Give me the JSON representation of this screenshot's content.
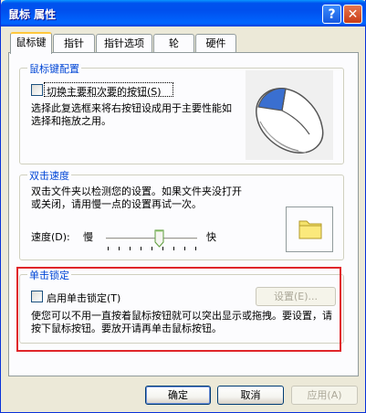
{
  "window": {
    "title": "鼠标 属性",
    "help_glyph": "?",
    "close_glyph": "✕"
  },
  "tabs": [
    {
      "label": "鼠标键",
      "active": true
    },
    {
      "label": "指针",
      "active": false
    },
    {
      "label": "指针选项",
      "active": false
    },
    {
      "label": "轮",
      "active": false
    },
    {
      "label": "硬件",
      "active": false
    }
  ],
  "button_config": {
    "title": "鼠标键配置",
    "checkbox_label": "切换主要和次要的按钮(S)",
    "checked": false,
    "description": "选择此复选框来将右按钮设成用于主要性能如选择和拖放之用。"
  },
  "double_click": {
    "title": "双击速度",
    "description": "双击文件夹以检测您的设置。如果文件夹没打开或关闭，请用慢一点的设置再试一次。",
    "speed_label": "速度(D):",
    "slow_label": "慢",
    "fast_label": "快",
    "speed_level_fraction": 0.55
  },
  "click_lock": {
    "title": "单击锁定",
    "checkbox_label": "启用单击锁定(T)",
    "checked": false,
    "settings_button": "设置(E)...",
    "description": "使您可以不用一直按着鼠标按钮就可以突出显示或拖拽。要设置，请按下鼠标按钮。要放开请再单击鼠标按钮。"
  },
  "footer": {
    "ok": "确定",
    "cancel": "取消",
    "apply": "应用(A)"
  },
  "colors": {
    "titlebar": "#0053ee",
    "group_title": "#0046d5",
    "highlight_box": "#e0262a"
  }
}
